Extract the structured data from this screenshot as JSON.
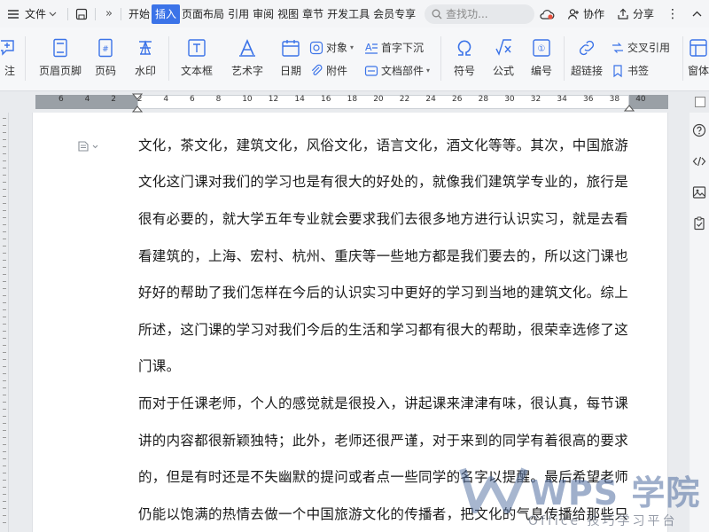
{
  "menubar": {
    "file_label": "文件",
    "tabs": [
      "开始",
      "插入",
      "页面布局",
      "引用",
      "审阅",
      "视图",
      "章节",
      "开发工具",
      "会员专享"
    ],
    "active_tab": "插入",
    "search_placeholder": "查找功...",
    "collab_label": "协作",
    "share_label": "分享"
  },
  "ribbon": {
    "comment": "注",
    "header_footer": "页眉页脚",
    "page_number": "页码",
    "watermark": "水印",
    "textbox": "文本框",
    "wordart": "艺术字",
    "date": "日期",
    "object": "对象",
    "attachment": "附件",
    "dropcap": "首字下沉",
    "doc_parts": "文档部件",
    "symbol": "符号",
    "formula": "公式",
    "numbering": "编号",
    "hyperlink": "超链接",
    "cross_ref": "交叉引用",
    "bookmark": "书签",
    "window": "窗体"
  },
  "ruler": {
    "numbers": [
      "6",
      "4",
      "2",
      "2",
      "4",
      "6",
      "8",
      "10",
      "12",
      "14",
      "16",
      "18",
      "20",
      "22",
      "24",
      "26",
      "28",
      "30",
      "32",
      "34",
      "36",
      "38",
      "40"
    ]
  },
  "document": {
    "lines": [
      "文化，茶文化，建筑文化，风俗文化，语言文化，酒文化等等。其次，中国旅游",
      "文化这门课对我们的学习也是有很大的好处的，就像我们建筑学专业的，旅行是",
      "很有必要的，就大学五年专业就会要求我们去很多地方进行认识实习，就是去看",
      "看建筑的，上海、宏村、杭州、重庆等一些地方都是我们要去的，所以这门课也",
      "好好的帮助了我们怎样在今后的认识实习中更好的学习到当地的建筑文化。综上",
      "所述，这门课的学习对我们今后的生活和学习都有很大的帮助，很荣幸选修了这",
      "门课。",
      "而对于任课老师，个人的感觉就是很投入，讲起课来津津有味，很认真，每节课",
      "讲的内容都很新颖独特；此外，老师还很严谨，对于来到的同学有着很高的要求",
      "的，但是有时还是不失幽默的提问或者点一些同学的名字以提醒。最后希望老师",
      "仍能以饱满的热情去做一个中国旅游文化的传播者，把文化的气息传播给那些只"
    ]
  },
  "watermark": {
    "logo": "WPS 学院",
    "sub": "Office 技巧学习平台"
  }
}
